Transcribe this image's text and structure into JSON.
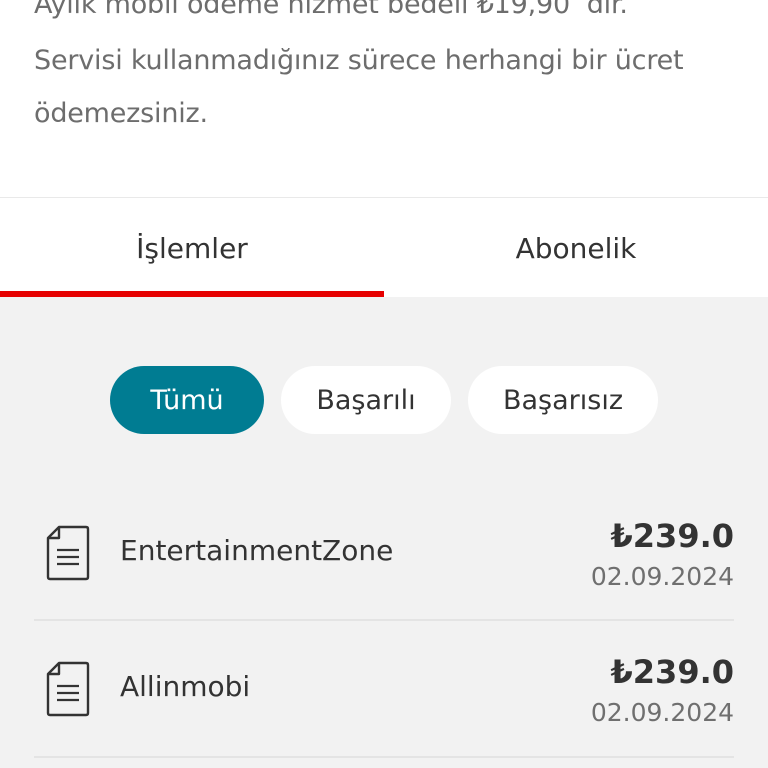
{
  "info": {
    "line1": "Aylık mobil ödeme hizmet bedeli ₺19,90 ’dir.",
    "line2": "Servisi kullanmadığınız sürece herhangi bir ücret",
    "line3": "ödemezsiniz."
  },
  "tabs": [
    {
      "label": "İşlemler",
      "active": true
    },
    {
      "label": "Abonelik",
      "active": false
    }
  ],
  "filters": [
    {
      "label": "Tümü",
      "selected": true
    },
    {
      "label": "Başarılı",
      "selected": false
    },
    {
      "label": "Başarısız",
      "selected": false
    }
  ],
  "transactions": [
    {
      "icon": "document-icon",
      "name": "EntertainmentZone",
      "amount": "₺239.0",
      "date": "02.09.2024"
    },
    {
      "icon": "document-icon",
      "name": "Allinmobi",
      "amount": "₺239.0",
      "date": "02.09.2024"
    }
  ],
  "colors": {
    "accent_red": "#e60000",
    "chip_selected": "#007c92",
    "background": "#f2f2f2"
  }
}
